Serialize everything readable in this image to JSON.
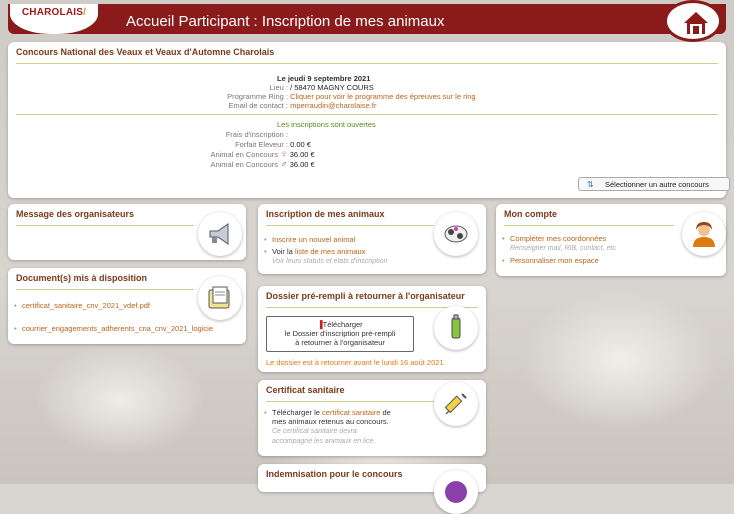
{
  "header": {
    "logo": "CHAROLAIS",
    "title": "Accueil Participant : Inscription de mes animaux"
  },
  "contest": {
    "title": "Concours National des Veaux et Veaux d'Automne Charolais",
    "date": "Le jeudi 9 septembre 2021",
    "lieu_label": "Lieu :",
    "lieu_value": "/ 58470 MAGNY COURS",
    "ring_label": "Programme Ring :",
    "ring_value": "Cliquer pour voir le programme des épreuves sur le ring",
    "email_label": "Email de contact :",
    "email_value": "mperraudin@charolaise.fr",
    "open_text": "Les inscriptions sont ouvertes",
    "frais_label": "Frais d'inscription :",
    "forfait_label": "Forfait Eleveur :",
    "forfait_value": "0.00 €",
    "animal_label": "Animal en Concours",
    "animal_f_value": "36.00 €",
    "animal_m_value": "36.00 €",
    "select_label": "Sélectionner un autre concours"
  },
  "messages": {
    "title": "Message des organisateurs"
  },
  "documents": {
    "title": "Document(s) mis à disposition",
    "items": [
      "certificat_sanitaire_cnv_2021_vdef.pdf",
      "courrier_engagements_adherents_cna_cnv_2021_logicie"
    ]
  },
  "inscription": {
    "title": "Inscription de mes animaux",
    "item1": "Inscrire un nouvel animal",
    "item2_prefix": "Voir la",
    "item2_link": "liste de mes animaux",
    "item2_sub": "Voir leurs statuts et états d'inscription"
  },
  "dossier": {
    "title": "Dossier pré-rempli à retourner à l'organisateur",
    "btn_line1": "Télécharger",
    "btn_line2": "le Dossier d'inscription pré-rempli",
    "btn_line3": "à retourner à l'organisateur",
    "deadline": "Le dossier est à retourner avant le lundi 16 août 2021"
  },
  "certificat": {
    "title": "Certificat sanitaire",
    "line1_prefix": "Télécharger le",
    "line1_link": "certificat sanitaire",
    "line1_suffix": "de",
    "line2": "mes animaux retenus au concours.",
    "sub1": "Ce certificat sanitaire devra",
    "sub2": "accompagné les animaux en lice."
  },
  "indemnisation": {
    "title": "Indemnisation pour le concours"
  },
  "compte": {
    "title": "Mon compte",
    "item1": "Compléter mes coordonnées",
    "item1_sub": "Renseigner mail, RIB, contact, etc",
    "item2": "Personnaliser mon espace"
  }
}
